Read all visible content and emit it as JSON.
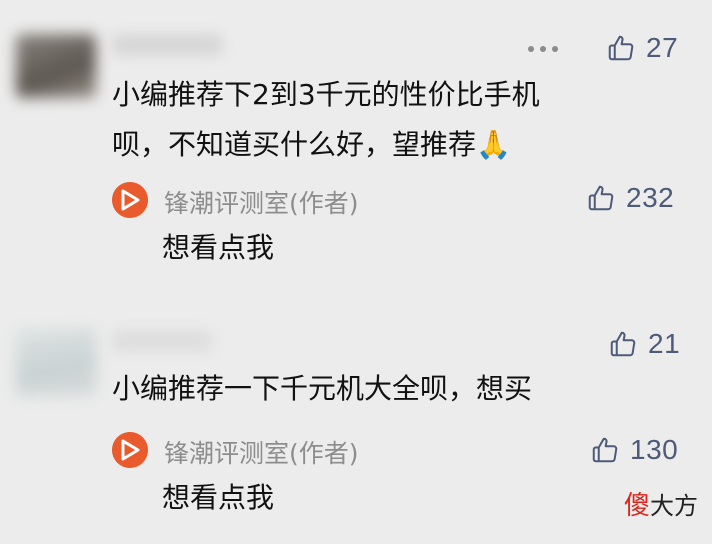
{
  "comments": [
    {
      "likes": "27",
      "text_lines": [
        "小编推荐下2到3千元的性价比手机",
        "呗，不知道买什么好，望推荐🙏"
      ],
      "reply": {
        "author": "锋潮评测室(作者)",
        "likes": "232",
        "text": "想看点我"
      }
    },
    {
      "likes": "21",
      "text_lines": [
        "小编推荐一下千元机大全呗，想买"
      ],
      "reply": {
        "author": "锋潮评测室(作者)",
        "likes": "130",
        "text": "想看点我"
      }
    }
  ],
  "watermark": {
    "part1": "傻",
    "part2": "大方"
  },
  "colors": {
    "background": "#ececec",
    "like_color": "#4d5a78",
    "author_logo": "#e95a2c",
    "watermark_red": "#d9261c"
  },
  "icons": {
    "like": "thumbs-up-icon",
    "more": "more-dots-icon",
    "author": "author-logo-icon"
  }
}
